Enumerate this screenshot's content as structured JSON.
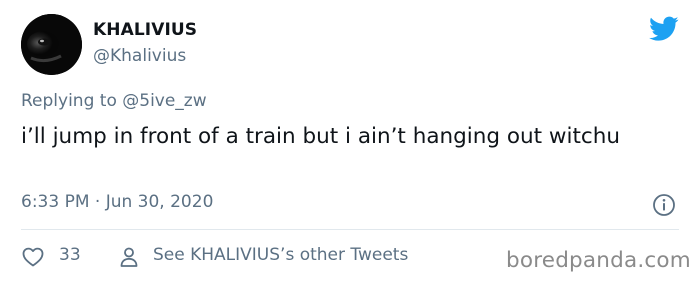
{
  "tweet": {
    "display_name": "KHALIVIUS",
    "handle": "@Khalivius",
    "replying_to_prefix": "Replying to ",
    "replying_to_user": "@5ive_zw",
    "text": "i’ll jump in front of a train but i ain’t hanging out witchu",
    "timestamp": "6:33 PM · Jun 30, 2020"
  },
  "actions": {
    "like_count": "33",
    "other_tweets_label": "See KHALIVIUS’s other Tweets"
  },
  "icons": {
    "brand": "twitter-bird-icon",
    "info": "info-icon",
    "like": "heart-icon",
    "profile": "user-icon"
  },
  "colors": {
    "twitter_blue": "#1da1f2",
    "secondary_text": "#5b7083",
    "primary_text": "#0f1419",
    "divider": "#e1e8ed",
    "watermark": "#8a8a8a"
  },
  "watermark": "boredpanda.com"
}
